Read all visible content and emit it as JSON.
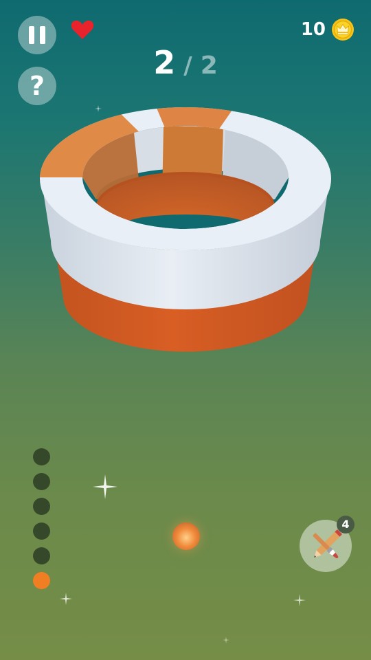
{
  "hud": {
    "pause_icon": "pause-icon",
    "help_label": "?",
    "lives_icon": "heart-icon",
    "coin_count": "10",
    "coin_icon": "crown-coin-icon"
  },
  "level": {
    "current": "2",
    "separator": "/",
    "total": "2"
  },
  "ring": {
    "colors": {
      "white": "#e9eff5",
      "orange": "#d35c24",
      "light_orange": "#e08a48",
      "bg": "#0f6a70"
    }
  },
  "progress": {
    "stages": 6,
    "active_stage": 6,
    "dot_color": "#36482a",
    "active_color": "#f07f24"
  },
  "tool": {
    "icon": "pencil-brush-icon",
    "count": "4"
  }
}
